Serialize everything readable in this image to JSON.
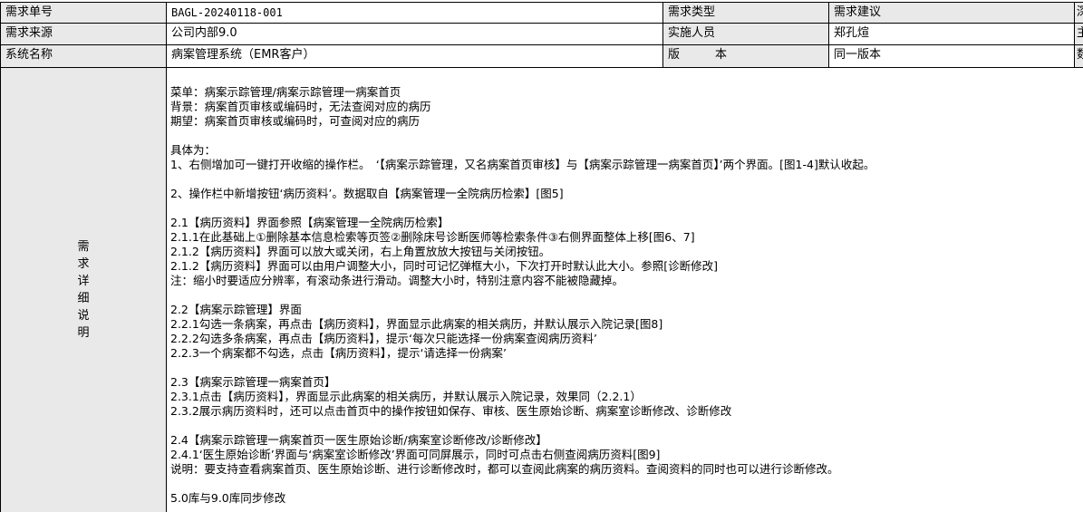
{
  "rows": [
    {
      "label": "需求单号",
      "value": "BAGL-20240118-001",
      "label2": "需求类型",
      "value2": "需求建议",
      "edge": "深"
    },
    {
      "label": "需求来源",
      "value": "公司内部9.0",
      "label2": "实施人员",
      "value2": "郑孔煊",
      "edge": "主"
    },
    {
      "label": "系统名称",
      "value": "病案管理系统（EMR客户）",
      "label2": "版　　　本",
      "value2": "同一版本",
      "edge": "数"
    }
  ],
  "detail": {
    "label_chars": [
      "需",
      "求",
      "详",
      "细",
      "说",
      "明"
    ],
    "lines": [
      "菜单：病案示踪管理/病案示踪管理一病案首页",
      "背景：病案首页审核或编码时，无法查阅对应的病历",
      "期望：病案首页审核或编码时，可查阅对应的病历",
      "",
      "具体为：",
      "1、右侧增加可一键打开收缩的操作栏。　‘【病案示踪管理，又名病案首页审核】与【病案示踪管理一病案首页】’两个界面。[图1-4]默认收起。",
      "",
      "2、操作栏中新增按钮‘病历资料’。数据取自【病案管理一全院病历检索】[图5]",
      "",
      "2.1【病历资料】界面参照【病案管理一全院病历检索】",
      "2.1.1在此基础上①删除基本信息检索等页签②删除床号诊断医师等检索条件③右侧界面整体上移[图6、7]",
      "2.1.2【病历资料】界面可以放大或关闭，右上角置放放大按钮与关闭按钮。",
      "2.1.2【病历资料】界面可以由用户调整大小，同时可记忆弹框大小，下次打开时默认此大小。参照[诊断修改]",
      "注：缩小时要适应分辨率，有滚动条进行滑动。调整大小时，特别注意内容不能被隐藏掉。",
      "",
      "2.2【病案示踪管理】界面",
      "2.2.1勾选一条病案，再点击【病历资料】，界面显示此病案的相关病历，并默认展示入院记录[图8]",
      "2.2.2勾选多条病案，再点击【病历资料】，提示‘每次只能选择一份病案查阅病历资料’",
      "2.2.3一个病案都不勾选，点击【病历资料】，提示‘请选择一份病案’",
      "",
      "2.3【病案示踪管理一病案首页】",
      "2.3.1点击【病历资料】，界面显示此病案的相关病历，并默认展示入院记录，效果同（2.2.1）",
      "2.3.2展示病历资料时，还可以点击首页中的操作按钮如保存、审核、医生原始诊断、病案室诊断修改、诊断修改",
      "",
      "2.4【病案示踪管理一病案首页一医生原始诊断/病案室诊断修改/诊断修改】",
      "2.4.1‘医生原始诊断’界面与‘病案室诊断修改’界面可同屏展示，同时可点击右侧查阅病历资料[图9]",
      "说明：要支持查看病案首页、医生原始诊断、进行诊断修改时，都可以查阅此病案的病历资料。查阅资料的同时也可以进行诊断修改。",
      "",
      "5.0库与9.0库同步修改"
    ]
  }
}
